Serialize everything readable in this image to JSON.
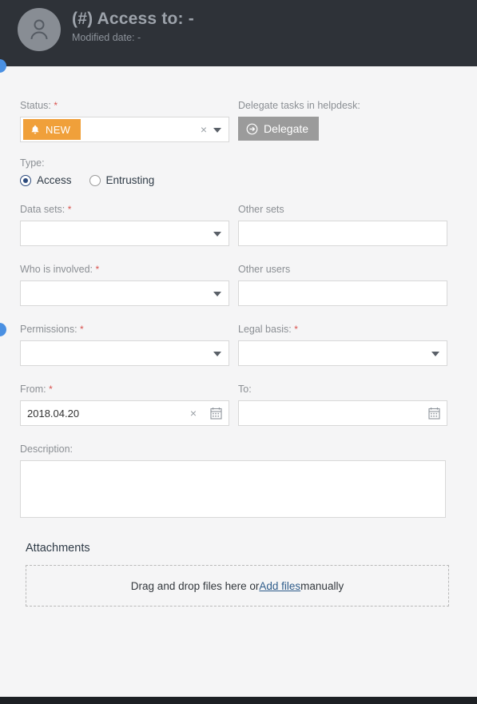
{
  "header": {
    "avatar_icon": "user-avatar-icon",
    "title": "(#) Access to: -",
    "subtitle": "Modified date: -"
  },
  "form": {
    "status": {
      "label": "Status:",
      "required": "*",
      "badge_text": "NEW",
      "badge_icon": "bell-icon",
      "badge_color": "#f0a03a",
      "clear_icon": "×",
      "dropdown_icon": "chevron-down-icon"
    },
    "delegate": {
      "label": "Delegate tasks in helpdesk:",
      "button_label": "Delegate",
      "button_icon": "arrow-circle-right-icon"
    },
    "type": {
      "label": "Type:",
      "options": [
        {
          "label": "Access",
          "selected": true
        },
        {
          "label": "Entrusting",
          "selected": false
        }
      ]
    },
    "data_sets": {
      "label": "Data sets:",
      "required": "*",
      "value": ""
    },
    "other_sets": {
      "label": "Other sets",
      "value": ""
    },
    "who_is_involved": {
      "label": "Who is involved:",
      "required": "*",
      "value": ""
    },
    "other_users": {
      "label": "Other users",
      "value": ""
    },
    "permissions": {
      "label": "Permissions:",
      "required": "*",
      "value": ""
    },
    "legal_basis": {
      "label": "Legal basis:",
      "required": "*",
      "value": ""
    },
    "from": {
      "label": "From:",
      "required": "*",
      "value": "2018.04.20",
      "clear_icon": "×",
      "calendar_icon": "calendar-icon"
    },
    "to": {
      "label": "To:",
      "value": "",
      "calendar_icon": "calendar-icon"
    },
    "description": {
      "label": "Description:",
      "value": ""
    }
  },
  "attachments": {
    "title": "Attachments",
    "drop_text_before": "Drag and drop files here or ",
    "link_text": "Add files",
    "drop_text_after": " manually"
  },
  "colors": {
    "header_bg": "#2e3238",
    "page_bg": "#f5f5f6",
    "accent_orange": "#f0a03a",
    "marker_blue": "#4a90e2",
    "required_red": "#d9534f"
  }
}
